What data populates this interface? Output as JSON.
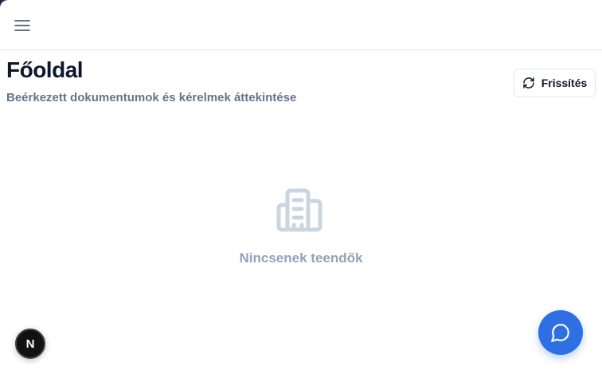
{
  "header": {
    "menu_icon": "hamburger-menu-icon"
  },
  "page": {
    "title": "Főoldal",
    "subtitle": "Beérkezett dokumentumok és kérelmek áttekintése"
  },
  "toolbar": {
    "refresh_label": "Frissítés",
    "refresh_icon": "refresh-icon"
  },
  "empty_state": {
    "icon": "building-icon",
    "message": "Nincsenek teendők"
  },
  "floating": {
    "next_badge_letter": "N",
    "chat_icon": "chat-bubble-icon"
  },
  "colors": {
    "primary": "#2f6fe4",
    "title": "#0f172a",
    "subtitle": "#64748b",
    "muted": "#94a3b8",
    "frame": "#1e2a4a"
  }
}
